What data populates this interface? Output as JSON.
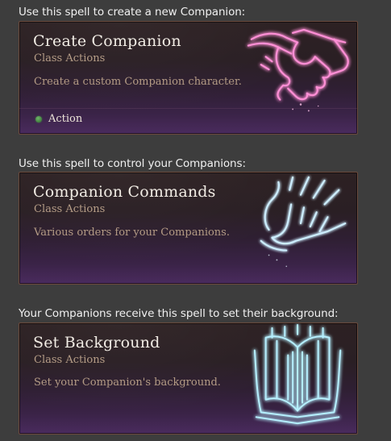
{
  "cards": [
    {
      "caption": "Use this spell to create a new Companion:",
      "title": "Create Companion",
      "subtitle": "Class Actions",
      "description": "Create a custom Companion character.",
      "cost_label": "Action",
      "icon": "handshake-icon",
      "glow_color": "#ff7fd0"
    },
    {
      "caption": "Use this spell to control your Companions:",
      "title": "Companion Commands",
      "subtitle": "Class Actions",
      "description": "Various orders for your Companions.",
      "icon": "command-hand-icon",
      "glow_color": "#bfe6ff"
    },
    {
      "caption": "Your Companions receive this spell to set their background:",
      "title": "Set Background",
      "subtitle": "Class Actions",
      "description": "Set your Companion's background.",
      "icon": "open-book-icon",
      "glow_color": "#a8ecff"
    }
  ],
  "colors": {
    "page_background": "#3d3d3d",
    "card_border": "#6b4a3c",
    "title_text": "#f1ece4",
    "subtitle_text": "#b49b85",
    "action_dot": "#4f9a4c"
  }
}
